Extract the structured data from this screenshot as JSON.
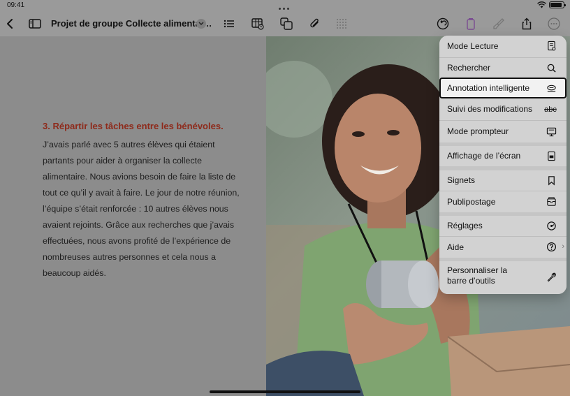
{
  "status_bar": {
    "time": "09:41",
    "battery_level": 0.9
  },
  "toolbar": {
    "document_title": "Projet de groupe Collecte alimentai…",
    "icons": [
      "back-icon",
      "sidebar-icon",
      "chevron-down-icon",
      "list-icon",
      "table-icon",
      "shapes-icon",
      "paperclip-icon",
      "grid-icon",
      "undo-icon",
      "color-icon",
      "brush-icon",
      "share-icon",
      "more-icon"
    ]
  },
  "document": {
    "heading": "3. Répartir les tâches entre les bénévoles.",
    "paragraph_lines": [
      "J’avais parlé avec  5 autres élèves qui étaient",
      "partants pour aider à organiser la collecte",
      "alimentaire. Nous avions besoin de faire la liste de",
      "tout ce qu’il y avait à faire. Le jour de notre réunion,",
      "l’équipe s’était renforcée : 10 autres élèves nous",
      "avaient rejoints. Grâce aux recherches que j’avais",
      "effectuées, nous avons profité de l’expérience de",
      "nombreuses autres personnes et cela nous a",
      "beaucoup aidés."
    ]
  },
  "menu": {
    "items": [
      {
        "label": "Mode Lecture",
        "icon": "reading-mode-icon"
      },
      {
        "label": "Rechercher",
        "icon": "search-icon"
      },
      {
        "label": "Annotation intelligente",
        "icon": "smart-annotation-icon",
        "selected": true
      },
      {
        "label": "Suivi des modifications",
        "icon": "strikethrough-icon",
        "icon_text": "abc"
      },
      {
        "label": "Mode prompteur",
        "icon": "presenter-icon"
      },
      {
        "label": "Affichage de l’écran",
        "icon": "screen-display-icon"
      },
      {
        "label": "Signets",
        "icon": "bookmark-icon"
      },
      {
        "label": "Publipostage",
        "icon": "mail-merge-icon"
      },
      {
        "label": "Réglages",
        "icon": "settings-icon"
      },
      {
        "label": "Aide",
        "icon": "help-icon"
      },
      {
        "label_line1": "Personnaliser la",
        "label_line2": "barre d’outils",
        "icon": "wrench-icon"
      }
    ]
  },
  "colors": {
    "heading": "#8e2a1b",
    "menu_background": "#d2d2d2",
    "selected_background": "#f2f2f2",
    "toolbar_background": "#9a9a9a"
  }
}
